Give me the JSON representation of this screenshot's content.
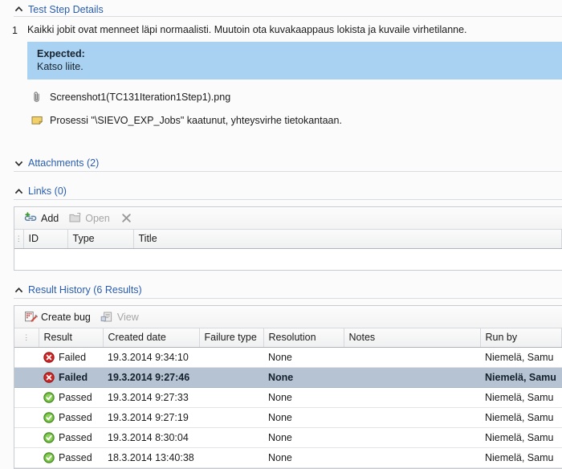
{
  "sections": {
    "test_step_details": {
      "title": "Test Step Details",
      "state": "expanded",
      "chevron": "chevron-up-icon"
    },
    "attachments": {
      "title": "Attachments (2)",
      "state": "collapsed",
      "chevron": "chevron-down-icon"
    },
    "links": {
      "title": "Links (0)",
      "state": "expanded",
      "chevron": "chevron-up-icon"
    },
    "result_history": {
      "title": "Result History (6 Results)",
      "state": "expanded",
      "chevron": "chevron-up-icon"
    }
  },
  "test_step": {
    "number": "1",
    "action_text": "Kaikki jobit ovat menneet läpi normaalisti. Muutoin ota kuvakaappaus lokista ja kuvaile virhetilanne.",
    "expected_label": "Expected:",
    "expected_text": "Katso liite.",
    "attachment": {
      "icon": "paperclip-icon",
      "name": "Screenshot1(TC131Iteration1Step1).png"
    },
    "comment": {
      "icon": "note-icon",
      "text": "Prosessi \"\\SIEVO_EXP_Jobs\" kaatunut, yhteysvirhe tietokantaan."
    }
  },
  "links_panel": {
    "toolbar": [
      {
        "label": "Add",
        "icon": "link-add-icon",
        "enabled": true
      },
      {
        "label": "Open",
        "icon": "open-folder-icon",
        "enabled": false
      },
      {
        "label": "",
        "icon": "delete-x-icon",
        "enabled": true
      }
    ],
    "columns": [
      "ID",
      "Type",
      "Title"
    ],
    "rows": []
  },
  "result_history": {
    "toolbar": [
      {
        "label": "Create bug",
        "icon": "create-bug-icon",
        "enabled": true
      },
      {
        "label": "View",
        "icon": "view-icon",
        "enabled": false
      }
    ],
    "columns": [
      "Result",
      "Created date",
      "Failure type",
      "Resolution",
      "Notes",
      "Run by"
    ],
    "rows": [
      {
        "result": "Failed",
        "status_icon": "failed-icon",
        "created_date": "19.3.2014 9:34:10",
        "failure_type": "",
        "resolution": "None",
        "notes": "",
        "run_by": "Niemelä, Samu",
        "selected": false
      },
      {
        "result": "Failed",
        "status_icon": "failed-icon",
        "created_date": "19.3.2014 9:27:46",
        "failure_type": "",
        "resolution": "None",
        "notes": "",
        "run_by": "Niemelä, Samu",
        "selected": true
      },
      {
        "result": "Passed",
        "status_icon": "passed-icon",
        "created_date": "19.3.2014 9:27:33",
        "failure_type": "",
        "resolution": "None",
        "notes": "",
        "run_by": "Niemelä, Samu",
        "selected": false
      },
      {
        "result": "Passed",
        "status_icon": "passed-icon",
        "created_date": "19.3.2014 9:27:19",
        "failure_type": "",
        "resolution": "None",
        "notes": "",
        "run_by": "Niemelä, Samu",
        "selected": false
      },
      {
        "result": "Passed",
        "status_icon": "passed-icon",
        "created_date": "19.3.2014 8:30:04",
        "failure_type": "",
        "resolution": "None",
        "notes": "",
        "run_by": "Niemelä, Samu",
        "selected": false
      },
      {
        "result": "Passed",
        "status_icon": "passed-icon",
        "created_date": "18.3.2014 13:40:38",
        "failure_type": "",
        "resolution": "None",
        "notes": "",
        "run_by": "Niemelä, Samu",
        "selected": false
      }
    ]
  },
  "colors": {
    "link_blue": "#2a5db0",
    "expected_bg": "#a9d2f2",
    "selected_row": "#b6c3d2",
    "failed_red": "#cf2626",
    "passed_green": "#52a527",
    "page_bg": "#fbfbfb"
  }
}
